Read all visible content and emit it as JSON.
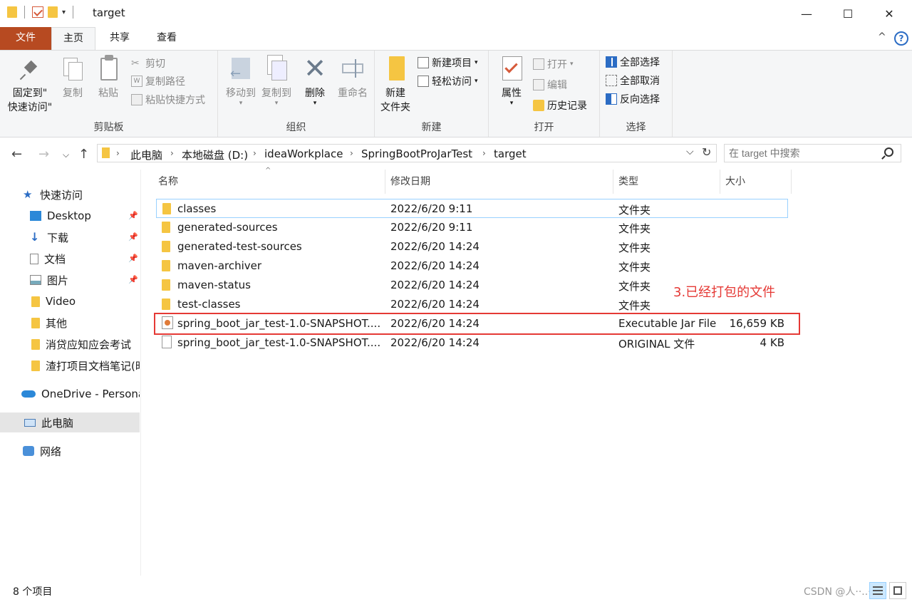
{
  "window": {
    "title": "target",
    "minimize": "—",
    "maximize": "☐",
    "close": "✕"
  },
  "menu_tabs": {
    "file": "文件",
    "home": "主页",
    "share": "共享",
    "view": "查看",
    "help_icon": "?"
  },
  "ribbon": {
    "clipboard": {
      "label": "剪贴板",
      "pin": "固定到\"\n快速访问\"",
      "pin_line1": "固定到\"",
      "pin_line2": "快速访问\"",
      "copy": "复制",
      "paste": "粘贴",
      "cut": "剪切",
      "copy_path": "复制路径",
      "paste_shortcut": "粘贴快捷方式"
    },
    "organize": {
      "label": "组织",
      "move_to": "移动到",
      "copy_to": "复制到",
      "delete": "删除",
      "rename": "重命名"
    },
    "new": {
      "label": "新建",
      "new_folder_line1": "新建",
      "new_folder_line2": "文件夹",
      "new_item": "新建项目",
      "easy_access": "轻松访问"
    },
    "open": {
      "label": "打开",
      "properties": "属性",
      "open": "打开",
      "edit": "编辑",
      "history": "历史记录"
    },
    "select": {
      "label": "选择",
      "select_all": "全部选择",
      "select_none": "全部取消",
      "invert": "反向选择"
    }
  },
  "address": {
    "crumbs": [
      "此电脑",
      "本地磁盘 (D:)",
      "ideaWorkplace",
      "SpringBootProJarTest",
      "target"
    ],
    "search_placeholder": "在 target 中搜索"
  },
  "nav": [
    {
      "label": "快速访问"
    },
    {
      "label": "Desktop"
    },
    {
      "label": "下载"
    },
    {
      "label": "文档"
    },
    {
      "label": "图片"
    },
    {
      "label": "Video"
    },
    {
      "label": "其他"
    },
    {
      "label": "消贷应知应会考试"
    },
    {
      "label": "渣打项目文档笔记(时"
    },
    {
      "label": "OneDrive - Persona"
    },
    {
      "label": "此电脑"
    },
    {
      "label": "网络"
    }
  ],
  "columns": {
    "name": "名称",
    "date": "修改日期",
    "type": "类型",
    "size": "大小",
    "sort_arrow": "^"
  },
  "files": [
    {
      "name": "classes",
      "date": "2022/6/20 9:11",
      "type": "文件夹",
      "size": ""
    },
    {
      "name": "generated-sources",
      "date": "2022/6/20 9:11",
      "type": "文件夹",
      "size": ""
    },
    {
      "name": "generated-test-sources",
      "date": "2022/6/20 14:24",
      "type": "文件夹",
      "size": ""
    },
    {
      "name": "maven-archiver",
      "date": "2022/6/20 14:24",
      "type": "文件夹",
      "size": ""
    },
    {
      "name": "maven-status",
      "date": "2022/6/20 14:24",
      "type": "文件夹",
      "size": ""
    },
    {
      "name": "test-classes",
      "date": "2022/6/20 14:24",
      "type": "文件夹",
      "size": ""
    },
    {
      "name": "spring_boot_jar_test-1.0-SNAPSHOT....",
      "date": "2022/6/20 14:24",
      "type": "Executable Jar File",
      "size": "16,659 KB"
    },
    {
      "name": "spring_boot_jar_test-1.0-SNAPSHOT....",
      "date": "2022/6/20 14:24",
      "type": "ORIGINAL 文件",
      "size": "4 KB"
    }
  ],
  "annotation": "3.已经打包的文件",
  "status": {
    "count": "8 个项目",
    "watermark": "CSDN @人··..··不"
  },
  "colors": {
    "file_tab": "#b74a21",
    "accent": "#2b6cc4",
    "annotation": "#e53935",
    "folder": "#f5c542"
  }
}
